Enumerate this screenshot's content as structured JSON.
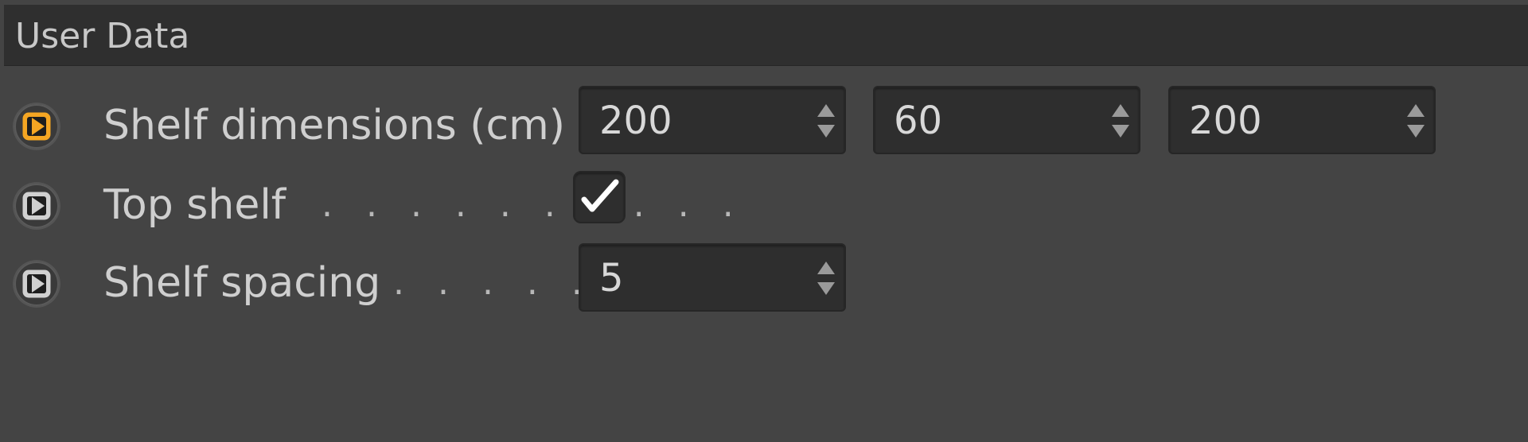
{
  "section": {
    "title": "User Data"
  },
  "params": {
    "shelf_dimensions": {
      "label": "Shelf dimensions (cm)",
      "values": [
        "200",
        "60",
        "200"
      ],
      "keyframe_state": "active"
    },
    "top_shelf": {
      "label": "Top shelf",
      "dots": ". . . . . . . . . .",
      "checked": true
    },
    "shelf_spacing": {
      "label": "Shelf spacing",
      "dots": ". . . . . . .",
      "value": "5"
    }
  },
  "icons": {
    "keyframe_active": "animation-keyframe-icon",
    "keyframe_inactive": "animation-keyframe-icon",
    "stepper": "up-down-arrows-icon",
    "check": "checkmark-icon"
  },
  "colors": {
    "background": "#444444",
    "header": "#2f2f2f",
    "field": "#2e2e2e",
    "text": "#cfcfcf",
    "accent_orange": "#f5a623"
  }
}
